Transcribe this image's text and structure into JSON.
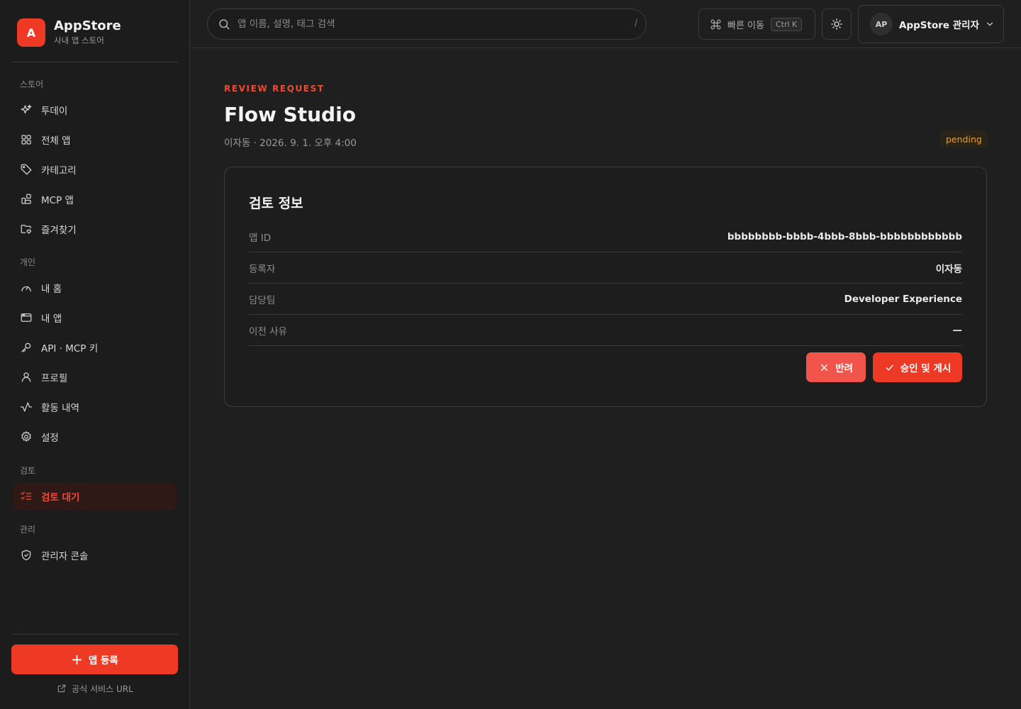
{
  "brand": {
    "logo_letter": "A",
    "name": "AppStore",
    "subtitle": "사내 앱 스토어",
    "accent_color": "#ee3a24"
  },
  "sidebar": {
    "sections": [
      {
        "label": "스토어",
        "items": [
          {
            "label": "투데이",
            "icon": "sparkles-icon"
          },
          {
            "label": "전체 앱",
            "icon": "grid-icon"
          },
          {
            "label": "카테고리",
            "icon": "tag-icon"
          },
          {
            "label": "MCP 앱",
            "icon": "blocks-icon"
          },
          {
            "label": "즐겨찾기",
            "icon": "folder-heart-icon"
          }
        ]
      },
      {
        "label": "개인",
        "items": [
          {
            "label": "내 홈",
            "icon": "gauge-icon"
          },
          {
            "label": "내 앱",
            "icon": "window-icon"
          },
          {
            "label": "API · MCP 키",
            "icon": "key-icon"
          },
          {
            "label": "프로필",
            "icon": "user-icon"
          },
          {
            "label": "활동 내역",
            "icon": "activity-icon"
          },
          {
            "label": "설정",
            "icon": "gear-icon"
          }
        ]
      },
      {
        "label": "검토",
        "items": [
          {
            "label": "검토 대기",
            "icon": "list-check-icon",
            "active": true
          }
        ]
      },
      {
        "label": "관리",
        "items": [
          {
            "label": "관리자 콘솔",
            "icon": "shield-icon"
          }
        ]
      }
    ],
    "add_app_label": "앱 등록",
    "official_link_label": "공식 서비스 URL"
  },
  "topbar": {
    "search_placeholder": "앱 이름, 설명, 태그 검색",
    "search_shortcut": "/",
    "quick_label": "빠른 이동",
    "quick_kbd": "Ctrl K",
    "user_initials": "AP",
    "user_name": "AppStore 관리자"
  },
  "main": {
    "eyebrow": "REVIEW REQUEST",
    "title": "Flow Studio",
    "meta": "이자동 · 2026. 9. 1. 오후 4:00",
    "status": "pending",
    "status_color": "#f0a020",
    "card": {
      "title": "검토 정보",
      "rows": [
        {
          "label": "앱 ID",
          "value": "bbbbbbbb-bbbb-4bbb-8bbb-bbbbbbbbbbbb"
        },
        {
          "label": "등록자",
          "value": "이자동"
        },
        {
          "label": "담당팀",
          "value": "Developer Experience"
        },
        {
          "label": "이전 사유",
          "value": "—"
        }
      ],
      "reject_label": "반려",
      "approve_label": "승인 및 게시"
    }
  }
}
